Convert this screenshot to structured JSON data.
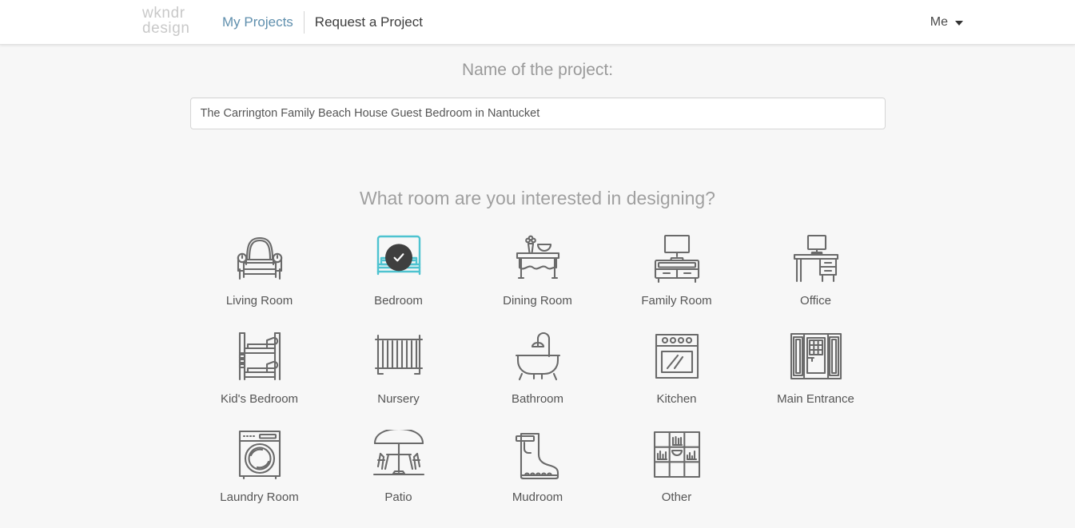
{
  "header": {
    "logo_line1": "wkndr",
    "logo_line2": "design",
    "nav": [
      {
        "label": "My Projects",
        "active": false
      },
      {
        "label": "Request a Project",
        "active": true
      }
    ],
    "account_label": "Me",
    "caret_icon": "chevron-down-icon"
  },
  "form": {
    "project_name_label": "Name of the project:",
    "project_name_value": "The Carrington Family Beach House Guest Bedroom in Nantucket",
    "project_name_placeholder": "Name of the project",
    "room_question": "What room are you interested in designing?"
  },
  "rooms": [
    {
      "label": "Living Room",
      "icon": "armchair-icon",
      "selected": false
    },
    {
      "label": "Bedroom",
      "icon": "bed-icon",
      "selected": true
    },
    {
      "label": "Dining Room",
      "icon": "dining-table-icon",
      "selected": false
    },
    {
      "label": "Family Room",
      "icon": "tv-console-icon",
      "selected": false
    },
    {
      "label": "Office",
      "icon": "desk-icon",
      "selected": false
    },
    {
      "label": "Kid's Bedroom",
      "icon": "bunk-bed-icon",
      "selected": false
    },
    {
      "label": "Nursery",
      "icon": "crib-icon",
      "selected": false
    },
    {
      "label": "Bathroom",
      "icon": "bathtub-icon",
      "selected": false
    },
    {
      "label": "Kitchen",
      "icon": "oven-icon",
      "selected": false
    },
    {
      "label": "Main Entrance",
      "icon": "front-door-icon",
      "selected": false
    },
    {
      "label": "Laundry Room",
      "icon": "washing-machine-icon",
      "selected": false
    },
    {
      "label": "Patio",
      "icon": "patio-umbrella-icon",
      "selected": false
    },
    {
      "label": "Mudroom",
      "icon": "rain-boot-icon",
      "selected": false
    },
    {
      "label": "Other",
      "icon": "shelving-unit-icon",
      "selected": false
    }
  ],
  "colors": {
    "selected_accent": "#4ec3d0",
    "icon_stroke": "#6a6a6a",
    "check_badge": "#3f3f3f",
    "nav_link": "#5f8fad",
    "page_background": "#f7f7f7",
    "header_background": "#ffffff"
  }
}
